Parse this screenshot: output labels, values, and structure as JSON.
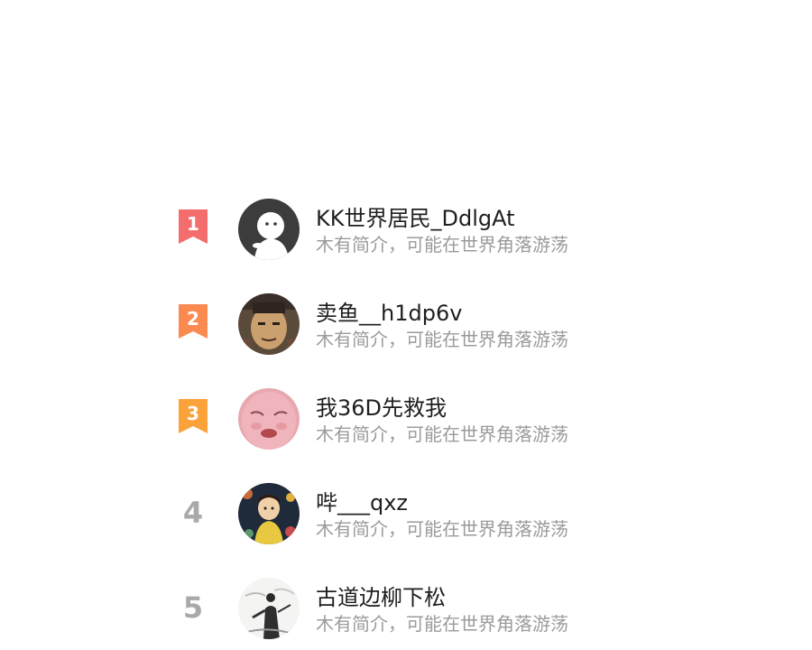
{
  "ranking": {
    "items": [
      {
        "rank": "1",
        "name": "KK世界居民_DdlgAt",
        "bio": "木有简介，可能在世界角落游荡",
        "badge_color": "#f46d6d",
        "avatar": "ghost-avatar"
      },
      {
        "rank": "2",
        "name": "卖鱼__h1dp6v",
        "bio": "木有简介，可能在世界角落游荡",
        "badge_color": "#fb8a51",
        "avatar": "anime-face-avatar"
      },
      {
        "rank": "3",
        "name": "我36D先救我",
        "bio": "木有简介，可能在世界角落游荡",
        "badge_color": "#fba23a",
        "avatar": "crying-face-avatar"
      },
      {
        "rank": "4",
        "name": "哔___qxz",
        "bio": "木有简介，可能在世界角落游荡",
        "avatar": "child-art-avatar"
      },
      {
        "rank": "5",
        "name": "古道边柳下松",
        "bio": "木有简介，可能在世界角落游荡",
        "avatar": "ink-figure-avatar"
      }
    ]
  }
}
